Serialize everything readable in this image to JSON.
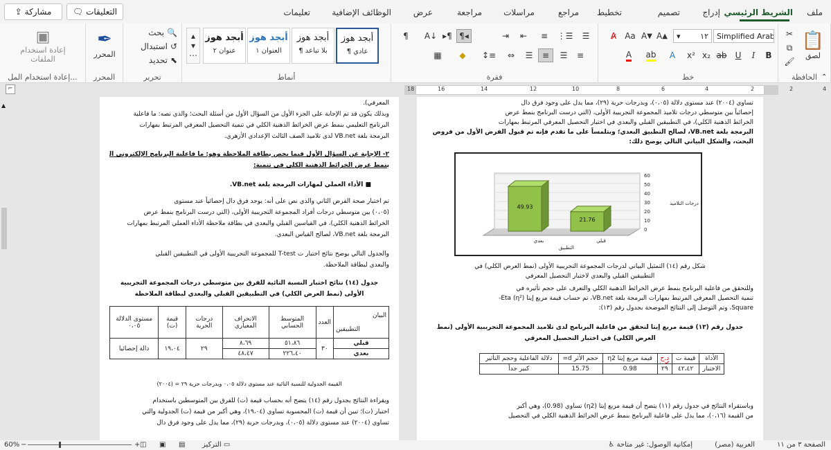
{
  "tabs": [
    "ملف",
    "الشريط الرئيسي",
    "إدراج",
    "تصميم",
    "تخطيط",
    "مراجع",
    "مراسلات",
    "مراجعة",
    "عرض",
    "الوظائف الإضافية",
    "تعليمات"
  ],
  "top_buttons": {
    "comments": "التعليقات",
    "share": "مشاركة"
  },
  "ribbon": {
    "clipboard": {
      "paste": "لصق",
      "label": "الحافظة"
    },
    "font": {
      "name": "Simplified Arabic",
      "size": "١٢",
      "label": "خط"
    },
    "paragraph": {
      "label": "فقرة"
    },
    "styles": {
      "items": [
        {
          "preview": "أبجد هوز",
          "name": "¶ عادي"
        },
        {
          "preview": "أبجد هوز",
          "name": "¶ بلا تباعد"
        },
        {
          "preview": "أبجد هوز",
          "name": "العنوان ١"
        },
        {
          "preview": "أبجد هوز",
          "name": "عنوان ٢"
        }
      ],
      "label": "أنماط"
    },
    "editing": {
      "find": "بحث",
      "replace": "استبدال",
      "select": "تحديد",
      "label": "تحرير"
    },
    "editor": {
      "name": "المحرر",
      "label": "المحرر"
    },
    "reuse": {
      "name": "إعادة استخدام الملفات",
      "label": "إعادة استخدام المل..."
    }
  },
  "ruler": {
    "numbers": [
      "18",
      "16",
      "14",
      "12",
      "10",
      "8",
      "6",
      "4",
      "2",
      "2",
      "4"
    ]
  },
  "right_page": {
    "lines": [
      "تساوي (٢٠٠٤) عند مستوى دلالة (٠،٠٥)، وبدرجات حرية (٢٩)، مما يدل على وجود فرق دال",
      "إحصائياً بين متوسطي درجات تلاميذ المجموعة التجريبية الأولى، (التي درست البرنامج بنمط عرض",
      "الخرائط الذهنية الكلي)، في التطبيقين القبلي والبعدي في اختبار التحصيل المعرفي المرتبط بمهارات",
      "البرمجة بلغة VB.net، لصالح التطبيق البعدي؛ وبتلمساً على ما تقدم فإنه تم قبول الفرض الأول من فروض",
      "البحث، والشكل البياني التالي يوضح ذلك:"
    ],
    "chart_data": {
      "type": "bar",
      "categories": [
        "قبلي",
        "بعدي"
      ],
      "values": [
        21.76,
        49.93
      ],
      "xlabel": "التطبيق",
      "ylabel": "درجات التلاميذ",
      "ylim": [
        0,
        60
      ],
      "yticks": [
        "60",
        "50",
        "40",
        "30",
        "20",
        "10",
        "0"
      ]
    },
    "caption": [
      "شكل رقم (١٤) التمثيل البياني لدرجات المجموعة التجريبية الأولى (نمط العرض الكلي) في",
      "التطبيقين القبلي والبعدي لاختبار التحصيل المعرفي"
    ],
    "lines2": [
      "وللتحقق من فاعلية البرنامج بنمط عرض الخرائط الذهنية الكلي والتعرف على حجم تأثيره في",
      "تنمية التحصيل المعرفي المرتبط بمهارات البرمجة بلغة VB.net، تم حساب قيمة مربع إيتا (η²) Eta-",
      "Square، وتم التوصل إلى النتائج الموضحة بجدول رقم (١٣):"
    ],
    "table_title": [
      "جدول رقم (١٣) قيمة مربع إيتا لتحقق من فاعلية البرنامج لدى تلاميذ المجموعة التجريبية الأولى (نمط",
      "العرض الكلي) في اختبار التحصيل المعرفي"
    ],
    "table": {
      "headers": [
        "الأداة",
        "قيمة ت",
        "د.ح",
        "قيمة مربع إيتا η2",
        "حجم الأثر d=",
        "دلالة الفاعلية وحجم التأثير"
      ],
      "row": [
        "الاختبار",
        "٤٢،٤٢",
        "٢٩",
        "0.98",
        "15.75",
        "كبير جداً"
      ]
    },
    "lines3": [
      "وباستقراء النتائج في جدول رقم (١١) يتضح أن قيمة مربع إيتا (η2) تساوي (0.98)، وهي أكبر",
      "من القيمة (٠،١٦)، مما يدل على فاعلية البرنامج بنمط عرض الخرائط الذهنية الكلي في التحصيل"
    ]
  },
  "left_page": {
    "lines": [
      "المعرفي).",
      "وبذلك يكون قد تم الإجابة على الجزء الأول من السؤال الأول من أسئلة البحث؛ والذي نصه: ما فاعلية",
      "البرنامج التعليمي بنمط عرض الخرائط الذهنية الكلي في تنمية التحصيل المعرفي المرتبط بمهارات",
      "البرمجة بلغة VB.net لدى تلاميذ الصف الثالث الإعدادي الأزهري."
    ],
    "q2": [
      "٢- الإجابة عن السؤال الأول فيما يخص بطاقة الملاحظة وهو: ما فاعلية البرنامج الإلكتروني المقدم",
      "بنمط عرض الخرائط الذهنية الكلي في تنمية:"
    ],
    "bullet": "الأداء العملي لمهارات البرمجة بلغة VB.net.",
    "lines2": [
      "تم اختبار صحة الفرض الثاني والذي نص على أنه: يوجد فرق دال إحصائياً عند مستوى",
      "(٠،٠٥) بين متوسطي درجات أفراد المجموعة التجريبية الأولى، (التي درست البرنامج بنمط عرض",
      "الخرائط الذهنية الكلي)، في القياسين القبلي والبعدي في بطاقة ملاحظة الأداء العملي المرتبط بمهارات",
      "البرمجة بلغة VB.net، لصالح القياس البعدي."
    ],
    "lines3": [
      "والجدول التالي يوضح نتائج اختبار ت T-test للمجموعة التجريبية الأولى في التطبيقين القبلي",
      "والبعدي لبطاقة الملاحظة."
    ],
    "table_title": [
      "جدول (١٤) نتائج اختبار النسبة التائية للفرق بين متوسطي درجات المجموعة التجريبية",
      "الأولى (نمط العرض الكلي) في التطبيقين القبلي والبعدي لبطاقة الملاحظة"
    ],
    "table": {
      "headers": [
        "البيان",
        "العدد",
        "المتوسط الحسابي",
        "الانحراف المعياري",
        "درجات الحرية",
        "قيمة (ت)",
        "مستوى الدلالة ٠،٠٥"
      ],
      "corner": "التطبيقين",
      "rows": [
        {
          "label": "قبلي",
          "n": "٣٠",
          "mean": "٥١،٨٦",
          "sd": "٨،٦٩",
          "df": "٢٩",
          "t": "١٩،٠٤",
          "sig": "دالة إحصائيا"
        },
        {
          "label": "بعدي",
          "mean": "٢٢٦،٤٠",
          "sd": "٤٨،٤٧"
        }
      ]
    },
    "table_note": "القيمة الجدولية للنسبة التائية عند مستوى دلالة ٠،٠٥ وبدرجات حرية ٢٩ = (٢٠٠٤)",
    "lines4": [
      "ويقراءة النتائج بجدول رقم (١٤) يتضح أنه بحساب قيمة (ت) للفرق بين المتوسطين باستخدام",
      "اختبار (ت)؛ تبين أن قيمة (ت) المحسوبة تساوي (١٩،٠٤)، وهي أكبر من قيمة (ت) الجدولية والتي",
      "تساوي (٢٠٠٤) عند مستوى دلالة (٠،٠٥)، وبدرجات حرية (٢٩)، مما يدل على وجود فرق دال"
    ]
  },
  "status": {
    "page": "الصفحة ٣ من ١١",
    "lang": "العربية (مصر)",
    "access": "إمكانية الوصول: غير متاحة",
    "focus": "التركيز",
    "zoom": "60%"
  }
}
